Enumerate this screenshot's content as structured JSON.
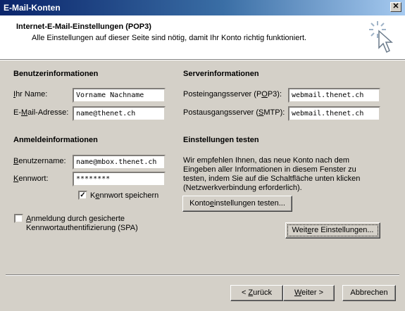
{
  "window": {
    "title": "E-Mail-Konten"
  },
  "header": {
    "title": "Internet-E-Mail-Einstellungen (POP3)",
    "subtitle": "Alle Einstellungen auf dieser Seite sind nötig, damit Ihr Konto richtig funktioniert."
  },
  "user_info": {
    "heading": "Benutzerinformationen",
    "name_label_u": "I",
    "name_label_rest": "hr Name:",
    "name_value": "Vorname Nachname",
    "email_label_pre": "E-",
    "email_label_u": "M",
    "email_label_rest": "ail-Adresse:",
    "email_value": "name@thenet.ch"
  },
  "server_info": {
    "heading": "Serverinformationen",
    "incoming_label_pre": "Posteingangsserver (P",
    "incoming_label_u": "O",
    "incoming_label_rest": "P3):",
    "incoming_value": "webmail.thenet.ch",
    "outgoing_label_pre": "Postausgangsserver (",
    "outgoing_label_u": "S",
    "outgoing_label_rest": "MTP):",
    "outgoing_value": "webmail.thenet.ch"
  },
  "login_info": {
    "heading": "Anmeldeinformationen",
    "username_label_u": "B",
    "username_label_rest": "enutzername:",
    "username_value": "name@mbox.thenet.ch",
    "password_label_u": "K",
    "password_label_rest": "ennwort:",
    "password_value": "********",
    "remember_label_pre": "K",
    "remember_label_u": "e",
    "remember_label_rest": "nnwort speichern",
    "remember_checked": "✓",
    "spa_label_u": "A",
    "spa_label_line1_rest": "nmeldung durch gesicherte",
    "spa_label_line2": "Kennwortauthentifizierung (SPA)"
  },
  "test_settings": {
    "heading": "Einstellungen testen",
    "description": "Wir empfehlen Ihnen, das neue Konto nach dem Eingeben aller Informationen in diesem Fenster zu testen, indem Sie auf die Schaltfläche unten klicken (Netzwerkverbindung erforderlich).",
    "test_button_pre": "Konto",
    "test_button_u": "e",
    "test_button_rest": "instellungen testen...",
    "more_button_pre": "Weit",
    "more_button_u": "e",
    "more_button_rest": "re Einstellungen..."
  },
  "footer": {
    "back_pre": "< ",
    "back_u": "Z",
    "back_rest": "urück",
    "next_u": "W",
    "next_rest": "eiter >",
    "cancel": "Abbrechen"
  },
  "icons": {
    "close": "close-icon",
    "header": "cursor-click-icon"
  }
}
